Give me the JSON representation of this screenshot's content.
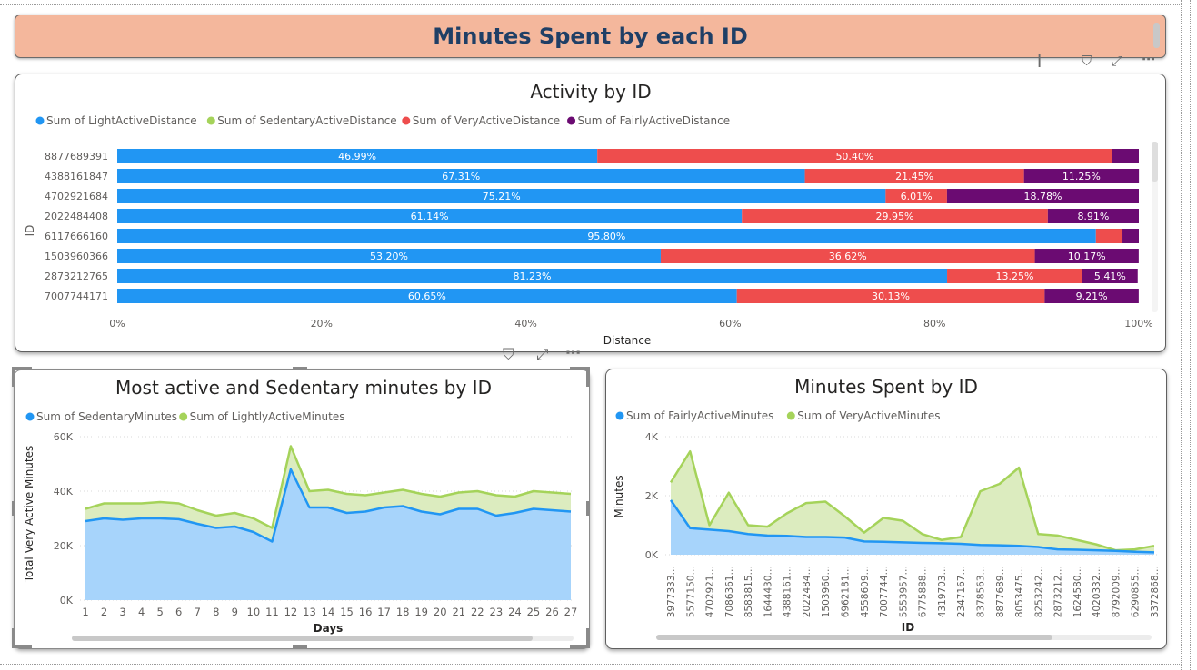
{
  "page": {
    "banner_title": "Minutes Spent by each ID"
  },
  "colors": {
    "banner_bg": "#f4b79c",
    "banner_text": "#1f3f66",
    "blue": "#2196f3",
    "blue_fill": "#a7d4fb",
    "green": "#a5d35a",
    "green_fill": "#dcecbf",
    "red": "#ee4d4d",
    "purple": "#6b0b72"
  },
  "toolbar_icons": [
    "filter-icon",
    "focus-mode-icon",
    "more-options-icon"
  ],
  "chart_data": [
    {
      "type": "bar",
      "orientation": "horizontal",
      "stacking": "100%",
      "title": "Activity by ID",
      "xlabel": "Distance",
      "ylabel": "ID",
      "xlim": [
        0,
        100
      ],
      "x_ticks": [
        "0%",
        "20%",
        "40%",
        "60%",
        "80%",
        "100%"
      ],
      "legend_position": "top-left",
      "legend": [
        "Sum of LightActiveDistance",
        "Sum of SedentaryActiveDistance",
        "Sum of VeryActiveDistance",
        "Sum of FairlyActiveDistance"
      ],
      "categories": [
        "8877689391",
        "4388161847",
        "4702921684",
        "2022484408",
        "6117666160",
        "1503960366",
        "2873212765",
        "7007744171"
      ],
      "series": [
        {
          "name": "Sum of LightActiveDistance",
          "color": "#2196f3",
          "values": [
            46.99,
            67.31,
            75.21,
            61.14,
            95.8,
            53.2,
            81.23,
            60.65
          ],
          "labels": [
            "46.99%",
            "67.31%",
            "75.21%",
            "61.14%",
            "95.80%",
            "53.20%",
            "81.23%",
            "60.65%"
          ]
        },
        {
          "name": "Sum of SedentaryActiveDistance",
          "color": "#a5d35a",
          "values": [
            0,
            0,
            0,
            0,
            0,
            0,
            0,
            0
          ],
          "labels": [
            "",
            "",
            "",
            "",
            "",
            "",
            "",
            ""
          ]
        },
        {
          "name": "Sum of VeryActiveDistance",
          "color": "#ee4d4d",
          "values": [
            50.4,
            21.45,
            6.01,
            29.95,
            2.6,
            36.62,
            13.25,
            30.13
          ],
          "labels": [
            "50.40%",
            "21.45%",
            "6.01%",
            "29.95%",
            "",
            "36.62%",
            "13.25%",
            "30.13%"
          ]
        },
        {
          "name": "Sum of FairlyActiveDistance",
          "color": "#6b0b72",
          "values": [
            2.61,
            11.25,
            18.78,
            8.91,
            1.6,
            10.17,
            5.41,
            9.21
          ],
          "labels": [
            "",
            "11.25%",
            "18.78%",
            "8.91%",
            "",
            "10.17%",
            "5.41%",
            "9.21%"
          ]
        }
      ]
    },
    {
      "type": "area",
      "stacking": "overlay",
      "title": "Most active and Sedentary minutes by ID",
      "xlabel": "Days",
      "ylabel": "Total Very Active Minutes",
      "ylim": [
        0,
        60000
      ],
      "y_ticks": [
        "0K",
        "20K",
        "40K",
        "60K"
      ],
      "legend_position": "top-left",
      "legend": [
        "Sum of SedentaryMinutes",
        "Sum of LightlyActiveMinutes"
      ],
      "x": [
        "1",
        "2",
        "3",
        "4",
        "5",
        "6",
        "7",
        "8",
        "9",
        "10",
        "11",
        "12",
        "13",
        "14",
        "15",
        "16",
        "17",
        "18",
        "19",
        "20",
        "21",
        "22",
        "23",
        "24",
        "25",
        "26",
        "27"
      ],
      "series": [
        {
          "name": "Sum of SedentaryMinutes",
          "color": "#2196f3",
          "values": [
            29000,
            30000,
            29500,
            30000,
            30000,
            29700,
            28000,
            26500,
            27000,
            25000,
            21500,
            48000,
            34000,
            34000,
            32000,
            32500,
            34000,
            34500,
            32500,
            31500,
            33500,
            33500,
            31000,
            32000,
            33500,
            33000,
            32500
          ]
        },
        {
          "name": "Sum of LightlyActiveMinutes",
          "color": "#a5d35a",
          "values": [
            33500,
            35500,
            35500,
            35500,
            36000,
            35500,
            33000,
            31000,
            32000,
            30000,
            26500,
            56500,
            40000,
            40500,
            39000,
            38500,
            39500,
            40500,
            39000,
            38000,
            39500,
            40000,
            38500,
            38000,
            40000,
            39500,
            39000
          ]
        }
      ]
    },
    {
      "type": "area",
      "stacking": "overlay",
      "title": "Minutes Spent by ID",
      "xlabel": "ID",
      "ylabel": "Minutes",
      "ylim": [
        0,
        4000
      ],
      "y_ticks": [
        "0K",
        "2K",
        "4K"
      ],
      "legend_position": "top-left",
      "legend": [
        "Sum of FairlyActiveMinutes",
        "Sum of VeryActiveMinutes"
      ],
      "x": [
        "3977333…",
        "5577150…",
        "4702921…",
        "7086361…",
        "8583815…",
        "1644430…",
        "4388161…",
        "2022484…",
        "1503960…",
        "6962181…",
        "4558609…",
        "7007744…",
        "5553957…",
        "6775888…",
        "4319703…",
        "2347167…",
        "8378563…",
        "8877689…",
        "8053475…",
        "8253242…",
        "2873212…",
        "1624580…",
        "4020332…",
        "8792009…",
        "6290855…",
        "3372868…"
      ],
      "series": [
        {
          "name": "Sum of FairlyActiveMinutes",
          "color": "#2196f3",
          "values": [
            1850,
            900,
            850,
            800,
            700,
            650,
            640,
            600,
            600,
            580,
            450,
            440,
            420,
            400,
            390,
            370,
            330,
            320,
            300,
            260,
            180,
            170,
            150,
            130,
            100,
            80
          ]
        },
        {
          "name": "Sum of VeryActiveMinutes",
          "color": "#a5d35a",
          "values": [
            2450,
            3500,
            1000,
            2100,
            1000,
            950,
            1400,
            1750,
            1800,
            1300,
            750,
            1250,
            1150,
            700,
            500,
            600,
            2150,
            2400,
            2950,
            700,
            650,
            500,
            350,
            150,
            180,
            300
          ]
        }
      ]
    }
  ]
}
